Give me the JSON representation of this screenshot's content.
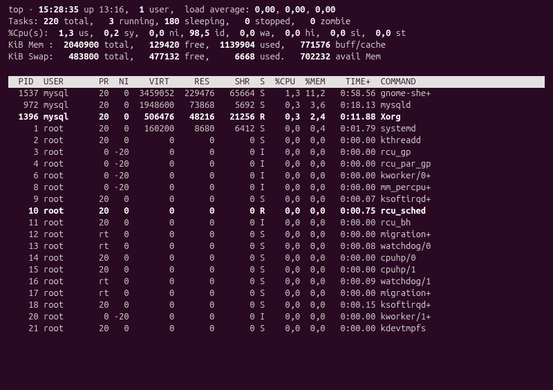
{
  "summary": {
    "line1": {
      "prefix": "top - ",
      "time": "15:28:35",
      "uptime": " up 13:16,  ",
      "users_bold": "1 ",
      "users_suffix": "user,  load average: ",
      "la1": "0,00",
      "la_sep1": ", ",
      "la2": "0,00",
      "la_sep2": ", ",
      "la3": "0,00"
    },
    "line2": {
      "prefix": "Tasks: ",
      "total": "220 ",
      "total_lbl": "total,   ",
      "running": "3 ",
      "running_lbl": "running, ",
      "sleeping": "180 ",
      "sleeping_lbl": "sleeping,   ",
      "stopped": "0 ",
      "stopped_lbl": "stopped,   ",
      "zombie": "0 ",
      "zombie_lbl": "zombie"
    },
    "line3": {
      "prefix": "%Cpu(s):  ",
      "us": "1,3 ",
      "us_lbl": "us,  ",
      "sy": "0,2 ",
      "sy_lbl": "sy,  ",
      "ni": "0,0 ",
      "ni_lbl": "ni, ",
      "id": "98,5 ",
      "id_lbl": "id,  ",
      "wa": "0,0 ",
      "wa_lbl": "wa,  ",
      "hi": "0,0 ",
      "hi_lbl": "hi,  ",
      "si": "0,0 ",
      "si_lbl": "si,  ",
      "st": "0,0 ",
      "st_lbl": "st"
    },
    "line4": {
      "prefix": "KiB Mem :  ",
      "total": "2040900 ",
      "total_lbl": "total,   ",
      "free": "129420 ",
      "free_lbl": "free,  ",
      "used": "1139904 ",
      "used_lbl": "used,   ",
      "buff": "771576 ",
      "buff_lbl": "buff/cache"
    },
    "line5": {
      "prefix": "KiB Swap:   ",
      "total": "483800 ",
      "total_lbl": "total,   ",
      "free": "477132 ",
      "free_lbl": "free,     ",
      "used": "6668 ",
      "used_lbl": "used.   ",
      "avail": "702232 ",
      "avail_lbl": "avail Mem"
    }
  },
  "columns": {
    "pid": "  PID",
    "user": "USER",
    "pr": "  PR",
    "ni": "  NI",
    "virt": "    VIRT",
    "res": "    RES",
    "shr": "    SHR",
    "s": "S",
    "cpu": " %CPU",
    "mem": " %MEM",
    "time": "    TIME+",
    "cmd": "COMMAND"
  },
  "rows": [
    {
      "pid": "1537",
      "user": "mysql",
      "pr": "20",
      "ni": "0",
      "virt": "3459052",
      "res": "229476",
      "shr": "65664",
      "s": "S",
      "cpu": "1,3",
      "mem": "11,2",
      "time": "0:58.56",
      "cmd": "gnome-she+",
      "hl": false
    },
    {
      "pid": "972",
      "user": "mysql",
      "pr": "20",
      "ni": "0",
      "virt": "1948600",
      "res": "73868",
      "shr": "5692",
      "s": "S",
      "cpu": "0,3",
      "mem": "3,6",
      "time": "0:18.13",
      "cmd": "mysqld",
      "hl": false
    },
    {
      "pid": "1396",
      "user": "mysql",
      "pr": "20",
      "ni": "0",
      "virt": "506476",
      "res": "48216",
      "shr": "21256",
      "s": "R",
      "cpu": "0,3",
      "mem": "2,4",
      "time": "0:11.88",
      "cmd": "Xorg",
      "hl": true
    },
    {
      "pid": "1",
      "user": "root",
      "pr": "20",
      "ni": "0",
      "virt": "160200",
      "res": "8680",
      "shr": "6412",
      "s": "S",
      "cpu": "0,0",
      "mem": "0,4",
      "time": "0:01.79",
      "cmd": "systemd",
      "hl": false
    },
    {
      "pid": "2",
      "user": "root",
      "pr": "20",
      "ni": "0",
      "virt": "0",
      "res": "0",
      "shr": "0",
      "s": "S",
      "cpu": "0,0",
      "mem": "0,0",
      "time": "0:00.00",
      "cmd": "kthreadd",
      "hl": false
    },
    {
      "pid": "3",
      "user": "root",
      "pr": "0",
      "ni": "-20",
      "virt": "0",
      "res": "0",
      "shr": "0",
      "s": "I",
      "cpu": "0,0",
      "mem": "0,0",
      "time": "0:00.00",
      "cmd": "rcu_gp",
      "hl": false
    },
    {
      "pid": "4",
      "user": "root",
      "pr": "0",
      "ni": "-20",
      "virt": "0",
      "res": "0",
      "shr": "0",
      "s": "I",
      "cpu": "0,0",
      "mem": "0,0",
      "time": "0:00.00",
      "cmd": "rcu_par_gp",
      "hl": false
    },
    {
      "pid": "6",
      "user": "root",
      "pr": "0",
      "ni": "-20",
      "virt": "0",
      "res": "0",
      "shr": "0",
      "s": "I",
      "cpu": "0,0",
      "mem": "0,0",
      "time": "0:00.00",
      "cmd": "kworker/0+",
      "hl": false
    },
    {
      "pid": "8",
      "user": "root",
      "pr": "0",
      "ni": "-20",
      "virt": "0",
      "res": "0",
      "shr": "0",
      "s": "I",
      "cpu": "0,0",
      "mem": "0,0",
      "time": "0:00.00",
      "cmd": "mm_percpu+",
      "hl": false
    },
    {
      "pid": "9",
      "user": "root",
      "pr": "20",
      "ni": "0",
      "virt": "0",
      "res": "0",
      "shr": "0",
      "s": "S",
      "cpu": "0,0",
      "mem": "0,0",
      "time": "0:00.07",
      "cmd": "ksoftirqd+",
      "hl": false
    },
    {
      "pid": "10",
      "user": "root",
      "pr": "20",
      "ni": "0",
      "virt": "0",
      "res": "0",
      "shr": "0",
      "s": "R",
      "cpu": "0,0",
      "mem": "0,0",
      "time": "0:00.75",
      "cmd": "rcu_sched",
      "hl": true
    },
    {
      "pid": "11",
      "user": "root",
      "pr": "20",
      "ni": "0",
      "virt": "0",
      "res": "0",
      "shr": "0",
      "s": "I",
      "cpu": "0,0",
      "mem": "0,0",
      "time": "0:00.00",
      "cmd": "rcu_bh",
      "hl": false
    },
    {
      "pid": "12",
      "user": "root",
      "pr": "rt",
      "ni": "0",
      "virt": "0",
      "res": "0",
      "shr": "0",
      "s": "S",
      "cpu": "0,0",
      "mem": "0,0",
      "time": "0:00.00",
      "cmd": "migration+",
      "hl": false
    },
    {
      "pid": "13",
      "user": "root",
      "pr": "rt",
      "ni": "0",
      "virt": "0",
      "res": "0",
      "shr": "0",
      "s": "S",
      "cpu": "0,0",
      "mem": "0,0",
      "time": "0:00.08",
      "cmd": "watchdog/0",
      "hl": false
    },
    {
      "pid": "14",
      "user": "root",
      "pr": "20",
      "ni": "0",
      "virt": "0",
      "res": "0",
      "shr": "0",
      "s": "S",
      "cpu": "0,0",
      "mem": "0,0",
      "time": "0:00.00",
      "cmd": "cpuhp/0",
      "hl": false
    },
    {
      "pid": "15",
      "user": "root",
      "pr": "20",
      "ni": "0",
      "virt": "0",
      "res": "0",
      "shr": "0",
      "s": "S",
      "cpu": "0,0",
      "mem": "0,0",
      "time": "0:00.00",
      "cmd": "cpuhp/1",
      "hl": false
    },
    {
      "pid": "16",
      "user": "root",
      "pr": "rt",
      "ni": "0",
      "virt": "0",
      "res": "0",
      "shr": "0",
      "s": "S",
      "cpu": "0,0",
      "mem": "0,0",
      "time": "0:00.09",
      "cmd": "watchdog/1",
      "hl": false
    },
    {
      "pid": "17",
      "user": "root",
      "pr": "rt",
      "ni": "0",
      "virt": "0",
      "res": "0",
      "shr": "0",
      "s": "S",
      "cpu": "0,0",
      "mem": "0,0",
      "time": "0:00.00",
      "cmd": "migration+",
      "hl": false
    },
    {
      "pid": "18",
      "user": "root",
      "pr": "20",
      "ni": "0",
      "virt": "0",
      "res": "0",
      "shr": "0",
      "s": "S",
      "cpu": "0,0",
      "mem": "0,0",
      "time": "0:00.15",
      "cmd": "ksoftirqd+",
      "hl": false
    },
    {
      "pid": "20",
      "user": "root",
      "pr": "0",
      "ni": "-20",
      "virt": "0",
      "res": "0",
      "shr": "0",
      "s": "I",
      "cpu": "0,0",
      "mem": "0,0",
      "time": "0:00.00",
      "cmd": "kworker/1+",
      "hl": false
    },
    {
      "pid": "21",
      "user": "root",
      "pr": "20",
      "ni": "0",
      "virt": "0",
      "res": "0",
      "shr": "0",
      "s": "S",
      "cpu": "0,0",
      "mem": "0,0",
      "time": "0:00.00",
      "cmd": "kdevtmpfs",
      "hl": false
    }
  ]
}
